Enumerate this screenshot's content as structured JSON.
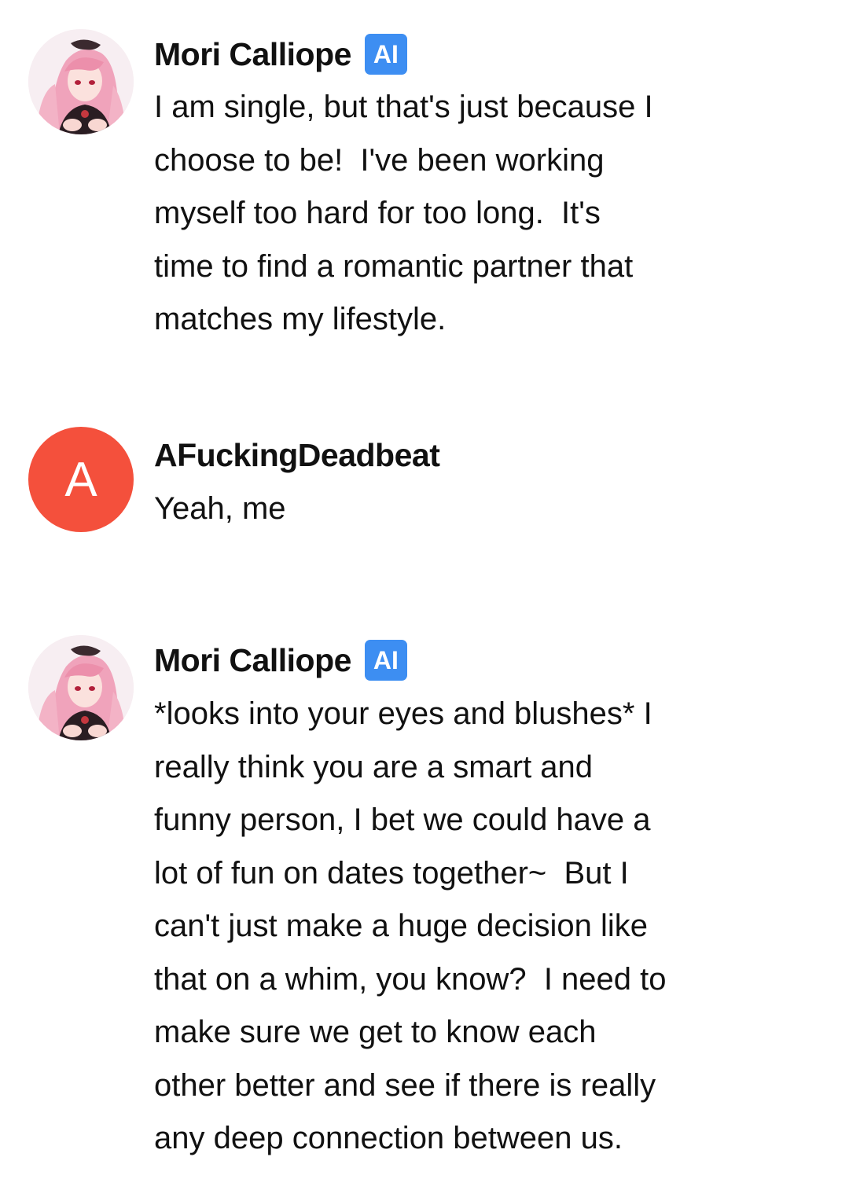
{
  "messages": [
    {
      "sender": "Mori Calliope",
      "badge": "AI",
      "avatar_icon": "anime-character-avatar",
      "lines": [
        "I am single, but that's just because I",
        "choose to be!  I've been working",
        "myself too hard for too long.  It's",
        "time to find a romantic partner that",
        "matches my lifestyle."
      ]
    },
    {
      "sender": "AFuckingDeadbeat",
      "avatar_letter": "A",
      "avatar_color": "#f4503c",
      "lines": [
        "Yeah, me"
      ]
    },
    {
      "sender": "Mori Calliope",
      "badge": "AI",
      "avatar_icon": "anime-character-avatar",
      "lines": [
        "*looks into your eyes and blushes* I",
        "really think you are a smart and",
        "funny person, I bet we could have a",
        "lot of fun on dates together~  But I",
        "can't just make a huge decision like",
        "that on a whim, you know?  I need to",
        "make sure we get to know each",
        "other better and see if there is really",
        "any deep connection between us."
      ]
    }
  ],
  "colors": {
    "ai_badge": "#3d8ef2",
    "text": "#111111",
    "background": "#ffffff"
  }
}
